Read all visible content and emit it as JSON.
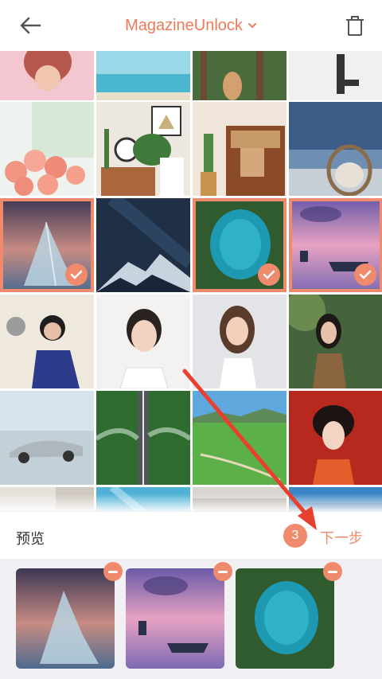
{
  "header": {
    "title": "MagazineUnlock",
    "back_icon": "back-arrow-icon",
    "delete_icon": "trash-icon"
  },
  "grid": {
    "tiles": [
      {
        "name": "woman-pink-portrait",
        "selected": false
      },
      {
        "name": "beach-ocean",
        "selected": false
      },
      {
        "name": "forest-legs",
        "selected": false
      },
      {
        "name": "jumping-silhouette",
        "selected": false
      },
      {
        "name": "pink-roses",
        "selected": false
      },
      {
        "name": "clock-plants-interior",
        "selected": false
      },
      {
        "name": "wood-cabinet-interior",
        "selected": false
      },
      {
        "name": "egg-chair-balcony",
        "selected": false
      },
      {
        "name": "ice-crystal-sunset",
        "selected": true
      },
      {
        "name": "night-sky-mountain",
        "selected": false
      },
      {
        "name": "aerial-lake-forest",
        "selected": true
      },
      {
        "name": "purple-lake-boat",
        "selected": true
      },
      {
        "name": "woman-blue-jacket",
        "selected": false
      },
      {
        "name": "woman-white-dress",
        "selected": false
      },
      {
        "name": "woman-white-top",
        "selected": false
      },
      {
        "name": "woman-forest",
        "selected": false
      },
      {
        "name": "silver-concept-car",
        "selected": false
      },
      {
        "name": "forest-road-aerial",
        "selected": false
      },
      {
        "name": "green-field-lake",
        "selected": false
      },
      {
        "name": "traditional-costume-woman",
        "selected": false
      }
    ]
  },
  "bar": {
    "preview_label": "预览",
    "count": "3",
    "next_label": "下一步"
  },
  "tray": {
    "items": [
      {
        "name": "ice-crystal-sunset"
      },
      {
        "name": "purple-lake-boat"
      },
      {
        "name": "aerial-lake-forest"
      }
    ]
  },
  "colors": {
    "accent": "#f08a6c",
    "title": "#ee7a5a",
    "arrow": "#e8402e"
  }
}
